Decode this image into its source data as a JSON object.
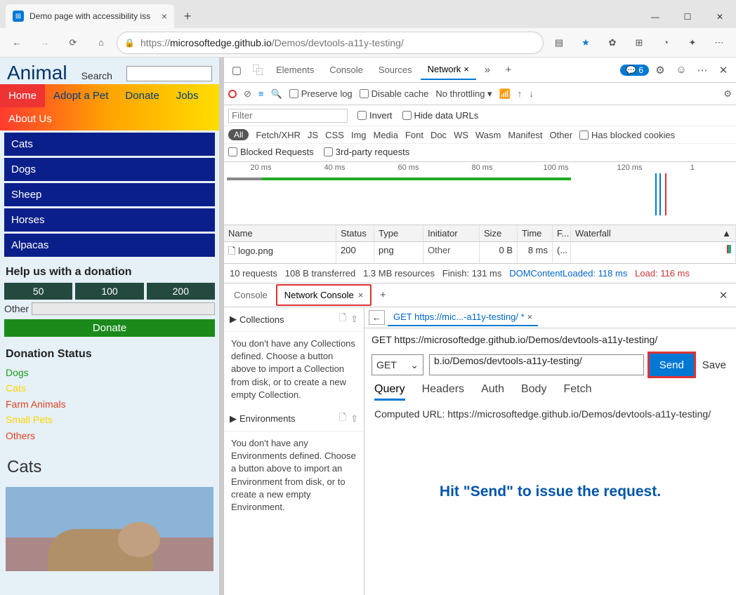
{
  "browser": {
    "tab_title": "Demo page with accessibility iss",
    "url_prefix": "https://",
    "url_host": "microsoftedge.github.io",
    "url_path": "/Demos/devtools-a11y-testing/"
  },
  "page": {
    "title": "Animal",
    "search_label": "Search",
    "nav": {
      "home": "Home",
      "adopt": "Adopt a Pet",
      "donate": "Donate",
      "jobs": "Jobs",
      "about": "About Us"
    },
    "cats": [
      "Cats",
      "Dogs",
      "Sheep",
      "Horses",
      "Alpacas"
    ],
    "donation_head": "Help us with a donation",
    "don_vals": [
      "50",
      "100",
      "200"
    ],
    "don_other": "Other",
    "don_submit": "Donate",
    "status_head": "Donation Status",
    "status": {
      "dogs": "Dogs",
      "cats": "Cats",
      "farm": "Farm Animals",
      "small": "Small Pets",
      "others": "Others"
    },
    "section": "Cats"
  },
  "devtools": {
    "tabs": {
      "elements": "Elements",
      "console": "Console",
      "sources": "Sources",
      "network": "Network"
    },
    "issues_count": "6",
    "toolbar": {
      "preserve": "Preserve log",
      "disable": "Disable cache",
      "throttle": "No throttling"
    },
    "filter": {
      "placeholder": "Filter",
      "invert": "Invert",
      "hide": "Hide data URLs"
    },
    "types": [
      "All",
      "Fetch/XHR",
      "JS",
      "CSS",
      "Img",
      "Media",
      "Font",
      "Doc",
      "WS",
      "Wasm",
      "Manifest",
      "Other"
    ],
    "blocked_cookies": "Has blocked cookies",
    "blocked_req": "Blocked Requests",
    "third_party": "3rd-party requests",
    "timeline": [
      "20 ms",
      "40 ms",
      "60 ms",
      "80 ms",
      "100 ms",
      "120 ms",
      "1"
    ],
    "table": {
      "headers": {
        "name": "Name",
        "status": "Status",
        "type": "Type",
        "initiator": "Initiator",
        "size": "Size",
        "time": "Time",
        "f": "F...",
        "waterfall": "Waterfall"
      },
      "rows": [
        {
          "name": "logo.png",
          "status": "200",
          "type": "png",
          "initiator": "Other",
          "size": "0 B",
          "time": "8 ms",
          "f": "(..."
        }
      ]
    },
    "summary": {
      "requests": "10 requests",
      "transferred": "108 B transferred",
      "resources": "1.3 MB resources",
      "finish": "Finish: 131 ms",
      "dcl": "DOMContentLoaded: 118 ms",
      "load": "Load: 116 ms"
    }
  },
  "drawer": {
    "tabs": {
      "console": "Console",
      "netconsole": "Network Console"
    },
    "collections": {
      "head": "Collections",
      "text": "You don't have any Collections defined. Choose a button above to import a Collection from disk, or to create a new empty Collection."
    },
    "environments": {
      "head": "Environments",
      "text": "You don't have any Environments defined. Choose a button above to import an Environment from disk, or to create a new empty Environment."
    },
    "request": {
      "tab": "GET https://mic...-a11y-testing/ *",
      "line": "GET https://microsoftedge.github.io/Demos/devtools-a11y-testing/",
      "method": "GET",
      "url": "b.io/Demos/devtools-a11y-testing/",
      "send": "Send",
      "save": "Save",
      "param_tabs": [
        "Query",
        "Headers",
        "Auth",
        "Body",
        "Fetch"
      ],
      "computed": "Computed URL: https://microsoftedge.github.io/Demos/devtools-a11y-testing/",
      "message": "Hit \"Send\" to issue the request."
    }
  }
}
